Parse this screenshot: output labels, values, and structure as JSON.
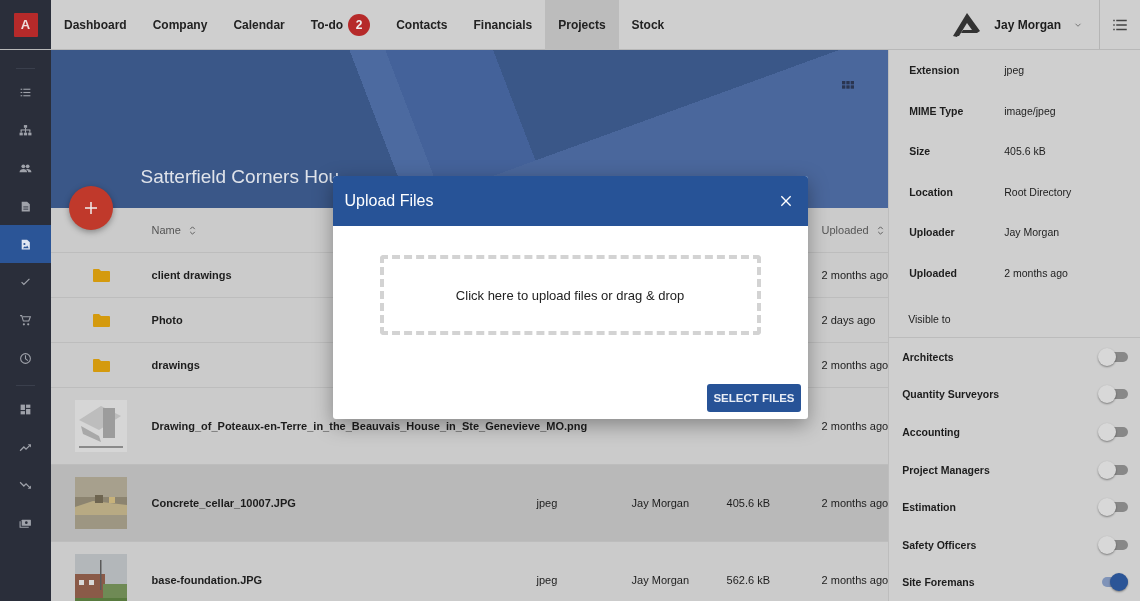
{
  "app": {
    "logo": "A"
  },
  "nav": [
    {
      "label": "Dashboard",
      "selected": false
    },
    {
      "label": "Company",
      "selected": false
    },
    {
      "label": "Calendar",
      "selected": false
    },
    {
      "label": "To-do",
      "selected": false,
      "badge": "2"
    },
    {
      "label": "Contacts",
      "selected": false
    },
    {
      "label": "Financials",
      "selected": false
    },
    {
      "label": "Projects",
      "selected": true
    },
    {
      "label": "Stock",
      "selected": false
    }
  ],
  "user": {
    "name": "Jay Morgan"
  },
  "sidebar": {
    "groups": [
      [
        {
          "selected": false
        },
        {
          "selected": false
        },
        {
          "selected": false
        },
        {
          "selected": false
        },
        {
          "selected": true
        },
        {
          "selected": false
        },
        {
          "selected": false
        },
        {
          "selected": false
        }
      ],
      [
        {
          "selected": false
        },
        {
          "selected": false
        },
        {
          "selected": false
        },
        {
          "selected": false
        }
      ]
    ]
  },
  "banner": {
    "title": "Satterfield Corners Hou"
  },
  "table": {
    "columns": [
      {
        "label": "Name"
      },
      {
        "label": "Uploaded"
      }
    ],
    "rows": [
      {
        "kind": "folder",
        "name": "client drawings",
        "uploaded": "2 months ago",
        "selected": false
      },
      {
        "kind": "folder",
        "name": "Photo",
        "uploaded": "2 days ago",
        "selected": false
      },
      {
        "kind": "folder",
        "name": "drawings",
        "uploaded": "2 months ago",
        "selected": false
      },
      {
        "kind": "file",
        "name": "Drawing_of_Poteaux-en-Terre_in_the_Beauvais_House_in_Ste_Genevieve_MO.png",
        "uploaded": "2 months ago",
        "selected": false
      },
      {
        "kind": "file",
        "name": "Concrete_cellar_10007.JPG",
        "type": "jpeg",
        "uploader": "Jay Morgan",
        "size": "405.6 kB",
        "uploaded": "2 months ago",
        "selected": true
      },
      {
        "kind": "file",
        "name": "base-foundation.JPG",
        "type": "jpeg",
        "uploader": "Jay Morgan",
        "size": "562.6 kB",
        "uploaded": "2 months ago",
        "selected": false
      }
    ]
  },
  "details": [
    {
      "label": "Extension",
      "value": "jpeg"
    },
    {
      "label": "MIME Type",
      "value": "image/jpeg"
    },
    {
      "label": "Size",
      "value": "405.6 kB"
    },
    {
      "label": "Location",
      "value": "Root Directory"
    },
    {
      "label": "Uploader",
      "value": "Jay Morgan"
    },
    {
      "label": "Uploaded",
      "value": "2 months ago"
    }
  ],
  "visibility": {
    "title": "Visible to",
    "groups": [
      {
        "label": "Architects",
        "on": false
      },
      {
        "label": "Quantity Surveyors",
        "on": false
      },
      {
        "label": "Accounting",
        "on": false
      },
      {
        "label": "Project Managers",
        "on": false
      },
      {
        "label": "Estimation",
        "on": false
      },
      {
        "label": "Safety Officers",
        "on": false
      },
      {
        "label": "Site Foremans",
        "on": true
      }
    ]
  },
  "dialog": {
    "title": "Upload Files",
    "dropzone": "Click here to upload files or drag & drop",
    "button": "SELECT FILES"
  }
}
